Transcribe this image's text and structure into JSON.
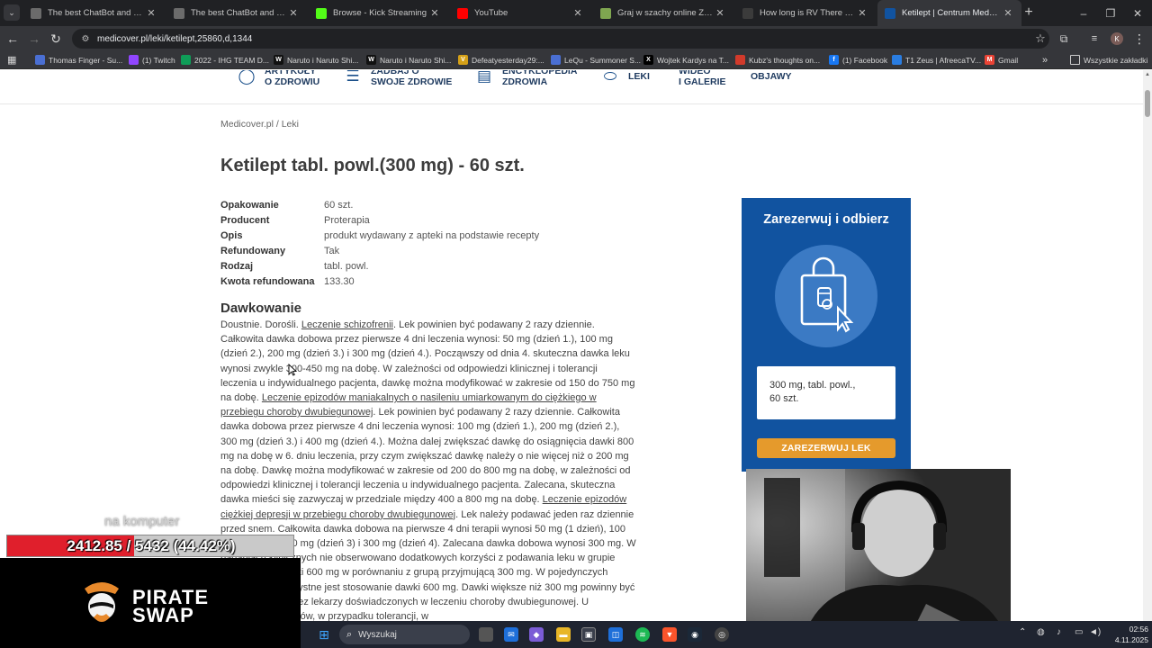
{
  "browser": {
    "tabs": [
      {
        "title": "The best ChatBot and Widgets",
        "icon_color": "#6b6b6b"
      },
      {
        "title": "The best ChatBot and Widg",
        "icon_color": "#6b6b6b"
      },
      {
        "title": "Browse - Kick Streaming",
        "icon_color": "#53fc18"
      },
      {
        "title": "YouTube",
        "icon_color": "#ff0000"
      },
      {
        "title": "Graj w szachy online ZA DARMO",
        "icon_color": "#7fa650"
      },
      {
        "title": "How long is RV There Yet?? | H",
        "icon_color": "#3b3b3b"
      },
      {
        "title": "Ketilept | Centrum Medyczne M",
        "icon_color": "#1153a0"
      }
    ],
    "url": "medicover.pl/leki/ketilept,25860,d,1344",
    "profile_initial": "K",
    "bookmarks": [
      {
        "label": "Thomas Finger - Su...",
        "icon_color": "#4a6fd3"
      },
      {
        "label": "(1) Twitch",
        "icon_color": "#9146ff"
      },
      {
        "label": "2022 - IHG TEAM D...",
        "icon_color": "#0f9d58"
      },
      {
        "label": "Naruto i Naruto Shi...",
        "icon_color": "#111111",
        "glyph": "W"
      },
      {
        "label": "Naruto i Naruto Shi...",
        "icon_color": "#111111",
        "glyph": "W"
      },
      {
        "label": "Defeatyesterday29:...",
        "icon_color": "#d4a017",
        "glyph": "V"
      },
      {
        "label": "LeQu - Summoner S...",
        "icon_color": "#4a6fd3"
      },
      {
        "label": "Wojtek Kardys na T...",
        "icon_color": "#000000",
        "glyph": "X"
      },
      {
        "label": "Kubz's thoughts on...",
        "icon_color": "#d13a2b"
      },
      {
        "label": "(1) Facebook",
        "icon_color": "#1877f2",
        "glyph": "f"
      },
      {
        "label": "T1 Zeus | AfreecaTV...",
        "icon_color": "#2a7de1"
      },
      {
        "label": "Gmail",
        "icon_color": "#ea4335",
        "glyph": "M"
      }
    ],
    "all_bookmarks_label": "Wszystkie zakładki"
  },
  "site": {
    "nav": [
      {
        "label": "ARTYKUŁY\nO ZDROWIU"
      },
      {
        "label": "ZADBAJ O\nSWOJE ZDROWIE"
      },
      {
        "label": "ENCYKLOPEDIA\nZDROWIA"
      },
      {
        "label": "LEKI"
      },
      {
        "label": "WIDEO\nI GALERIE"
      },
      {
        "label": "OBJAWY"
      }
    ],
    "breadcrumb": {
      "home": "Medicover.pl",
      "separator": " / ",
      "current": "Leki"
    },
    "title": "Ketilept tabl. powl.(300 mg) - 60 szt.",
    "attributes": [
      {
        "key": "Opakowanie",
        "value": "60 szt."
      },
      {
        "key": "Producent",
        "value": "Proterapia"
      },
      {
        "key": "Opis",
        "value": "produkt wydawany z apteki na podstawie recepty"
      },
      {
        "key": "Refundowany",
        "value": "Tak"
      },
      {
        "key": "Rodzaj",
        "value": "tabl. powl."
      },
      {
        "key": "Kwota refundowana",
        "value": "133.30"
      }
    ],
    "dosage_heading": "Dawkowanie",
    "dosage": [
      {
        "t": "Doustnie. Dorośli. "
      },
      {
        "t": "Leczenie schizofrenii",
        "link": true
      },
      {
        "t": ". Lek powinien być podawany 2 razy dziennie. Całkowita dawka dobowa przez pierwsze 4 dni leczenia wynosi: 50 mg (dzień 1.), 100 mg (dzień 2.), 200 mg (dzień 3.) i 300 mg (dzień 4.). Począwszy od dnia 4. skuteczna dawka leku wynosi zwykle 300-450 mg na dobę. W zależności od odpowiedzi klinicznej i tolerancji leczenia u indywidualnego pacjenta, dawkę można modyfikować w zakresie od 150 do 750 mg na dobę. "
      },
      {
        "t": "Leczenie epizodów maniakalnych o nasileniu umiarkowanym do ciężkiego w przebiegu choroby dwubiegunowej",
        "link": true
      },
      {
        "t": ". Lek powinien być podawany 2 razy dziennie. Całkowita dawka dobowa przez pierwsze 4 dni leczenia wynosi: 100 mg (dzień 1.), 200 mg (dzień 2.), 300 mg (dzień 3.) i 400 mg (dzień 4.). Można dalej zwiększać dawkę do osiągnięcia dawki 800 mg na dobę w 6. dniu leczenia, przy czym zwiększać dawkę należy o nie więcej niż o 200 mg na dobę. Dawkę można modyfikować w zakresie od 200 do 800 mg na dobę, w zależności od odpowiedzi klinicznej i tolerancji leczenia u indywidualnego pacjenta. Zalecana, skuteczna dawka mieści się zazwyczaj w przedziale między 400 a 800 mg na dobę. "
      },
      {
        "t": "Leczenie epizodów ciężkiej depresji w przebiegu choroby dwubiegunowej",
        "link": true
      },
      {
        "t": ". Lek należy podawać jeden raz dziennie przed snem. Całkowita dawka dobowa na pierwsze 4 dni terapii wynosi 50 mg (1 dzień), 100 mg (dzień 2), 200 mg (dzień 3) i 300 mg (dzień 4). Zalecana dawka dobowa wynosi 300 mg. W badaniach klinicznych nie obserwowano dodatkowych korzyści z podawania leku w grupie przyjmującej dawki 600 mg w porównaniu z grupą przyjmującą 300 mg. W pojedynczych przypadkach korzystne jest stosowanie dawki 600 mg. Dawki większe niż 300 mg powinny być wprowadzane przez lekarzy doświadczonych w leczeniu choroby dwubiegunowej. U niektórych pacjentów, w przypadku tolerancji, w"
      }
    ],
    "reserve_panel": {
      "title": "Zarezerwuj i odbierz",
      "variant_line1": "300 mg, tabl. powl.,",
      "variant_line2": "60 szt.",
      "button": "ZAREZERWUJ LEK",
      "panel_color": "#1153a0",
      "button_color": "#e59a2c"
    }
  },
  "stream_overlay": {
    "label": "na komputer",
    "progress_text": "2412.85 / 5432 (44.42%)",
    "progress_fraction": 0.4442,
    "sponsor_line1": "PIRATE",
    "sponsor_line2": "SWAP"
  },
  "taskbar": {
    "search_placeholder": "Wyszukaj",
    "time": "02:56",
    "date": "4.11.2025"
  }
}
